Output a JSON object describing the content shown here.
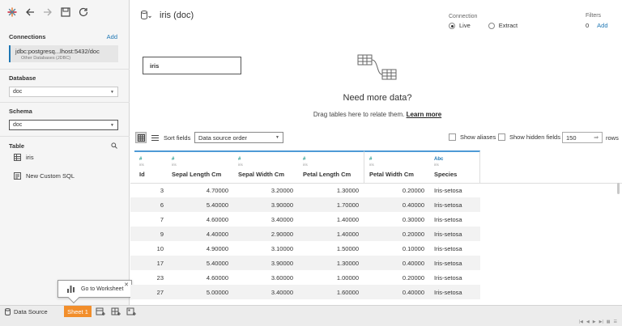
{
  "sidebar": {
    "connections_label": "Connections",
    "add_label": "Add",
    "connection_main": "jdbc:postgresq...lhost:5432/doc",
    "connection_sub": "Other Databases (JDBC)",
    "database_label": "Database",
    "database_value": "doc",
    "schema_label": "Schema",
    "schema_value": "doc",
    "table_label": "Table",
    "tables": [
      {
        "label": "iris",
        "icon": "table-icon"
      },
      {
        "label": "New Custom SQL",
        "icon": "custom-sql-icon"
      }
    ]
  },
  "tooltip": {
    "label": "Go to Worksheet"
  },
  "bottom": {
    "data_source_tab": "Data Source",
    "sheet_tab": "Sheet 1"
  },
  "header": {
    "title": "iris (doc)",
    "connection_label": "Connection",
    "live_label": "Live",
    "extract_label": "Extract",
    "connection_selected": "Live",
    "filters_label": "Filters",
    "filters_count": "0",
    "filters_add": "Add"
  },
  "canvas": {
    "table_box": "iris",
    "need_title": "Need more data?",
    "need_sub": "Drag tables here to relate them.",
    "learn_more": "Learn more"
  },
  "grid_toolbar": {
    "sort_label": "Sort fields",
    "sort_value": "Data source order",
    "show_aliases": "Show aliases",
    "show_hidden": "Show hidden fields",
    "rows_value": "150",
    "rows_label": "rows"
  },
  "grid": {
    "columns": [
      {
        "icon": "#",
        "source": "iris",
        "name": "Id"
      },
      {
        "icon": "#",
        "source": "iris",
        "name": "Sepal Length Cm"
      },
      {
        "icon": "#",
        "source": "iris",
        "name": "Sepal Width Cm"
      },
      {
        "icon": "#",
        "source": "iris",
        "name": "Petal Length Cm"
      },
      {
        "icon": "#",
        "source": "iris",
        "name": "Petal Width Cm"
      },
      {
        "icon": "Abc",
        "source": "iris",
        "name": "Species"
      }
    ],
    "rows": [
      [
        "3",
        "4.70000",
        "3.20000",
        "1.30000",
        "0.20000",
        "Iris-setosa"
      ],
      [
        "6",
        "5.40000",
        "3.90000",
        "1.70000",
        "0.40000",
        "Iris-setosa"
      ],
      [
        "7",
        "4.60000",
        "3.40000",
        "1.40000",
        "0.30000",
        "Iris-setosa"
      ],
      [
        "9",
        "4.40000",
        "2.90000",
        "1.40000",
        "0.20000",
        "Iris-setosa"
      ],
      [
        "10",
        "4.90000",
        "3.10000",
        "1.50000",
        "0.10000",
        "Iris-setosa"
      ],
      [
        "17",
        "5.40000",
        "3.90000",
        "1.30000",
        "0.40000",
        "Iris-setosa"
      ],
      [
        "23",
        "4.60000",
        "3.60000",
        "1.00000",
        "0.20000",
        "Iris-setosa"
      ],
      [
        "27",
        "5.00000",
        "3.40000",
        "1.60000",
        "0.40000",
        "Iris-setosa"
      ]
    ]
  }
}
